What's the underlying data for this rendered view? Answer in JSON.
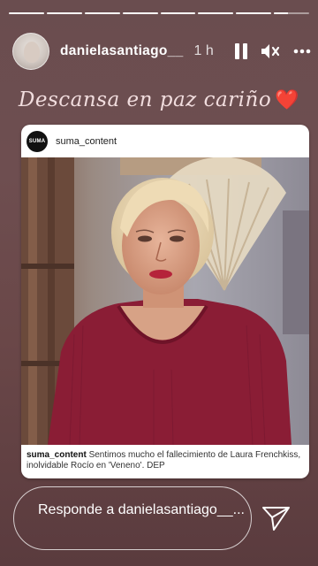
{
  "progress": {
    "segments_total": 8,
    "segments_completed": 7,
    "current_segment_fill": 0.4
  },
  "header": {
    "username": "danielasantiago__",
    "time": "1 h",
    "controls": {
      "pause": "pause-icon",
      "mute": "speaker-muted-icon",
      "more": "more-dots-icon"
    }
  },
  "caption": {
    "text": "Descansa en paz cariño",
    "emoji": "❤️"
  },
  "post": {
    "account": "suma_content",
    "logo_text": "SUMA",
    "caption_user": "suma_content",
    "caption_text": "Sentimos mucho el fallecimiento de Laura Frenchkiss, inolvidable Rocío en 'Veneno'. DEP"
  },
  "reply": {
    "placeholder": "Responde a danielasantiago__..."
  },
  "colors": {
    "background": "#6a4d4f",
    "heart": "#e0232e"
  }
}
